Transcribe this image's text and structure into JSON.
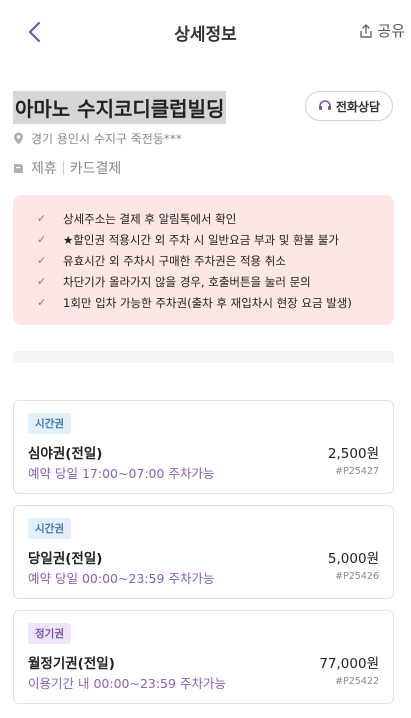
{
  "header": {
    "title": "상세정보",
    "share_label": "공유"
  },
  "place": {
    "name": "아마노 수지코디클럽빌딩",
    "call_label": "전화상담",
    "address": "경기 용인시 수지구 죽전동***",
    "tags": [
      "제휴",
      "카드결제"
    ]
  },
  "notices": [
    "상세주소는 결제 후 알림톡에서 확인",
    "★할인권 적용시간 외 주차 시 일반요금 부과 및 환불 불가",
    "유효시간 외 주차시 구매한 주차권은 적용 취소",
    "차단기가 올라가지 않을 경우, 호출버튼을 눌러 문의",
    "1회만 입차 가능한 주차권(출차 후 재입차시 현장 요금 발생)"
  ],
  "tickets": [
    {
      "badge": "시간권",
      "badge_color": "#3f79b5",
      "name": "심야권(전일)",
      "price": "2,500원",
      "time": "예약 당일 17:00~07:00 주차가능",
      "code": "#P25427"
    },
    {
      "badge": "시간권",
      "badge_color": "#3f79b5",
      "name": "당일권(전일)",
      "price": "5,000원",
      "time": "예약 당일 00:00~23:59 주차가능",
      "code": "#P25426"
    },
    {
      "badge": "정기권",
      "badge_color": "#7d52b3",
      "name": "월정기권(전일)",
      "price": "77,000원",
      "time": "이용기간 내 00:00~23:59 주차가능",
      "code": "#P25422"
    }
  ],
  "icons": {
    "back": "chevron-left-icon",
    "share": "share-icon",
    "call": "headset-icon",
    "location": "location-pin-icon",
    "tag": "tag-icon",
    "check": "check-icon"
  },
  "colors": {
    "accent": "#7d52b3",
    "notice_bg": "#fde6e3",
    "check": "#e25446"
  }
}
